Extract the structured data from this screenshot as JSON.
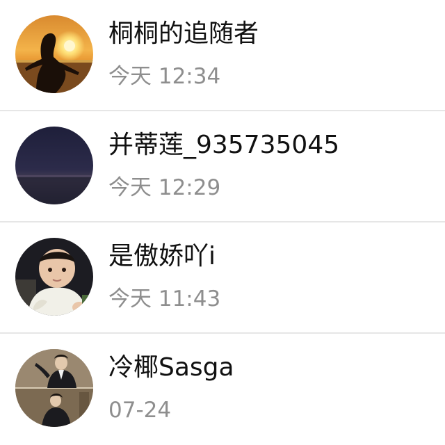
{
  "items": [
    {
      "name": "桐桐的追随者",
      "time": "今天 12:34",
      "avatar": "sunset-silhouette"
    },
    {
      "name": "并蒂莲_935735045",
      "time": "今天 12:29",
      "avatar": "dark-dusk-sky"
    },
    {
      "name": "是傲娇吖i",
      "time": "今天 11:43",
      "avatar": "baby-photo"
    },
    {
      "name": "冷椰Sasga",
      "time": "07-24",
      "avatar": "man-in-suit-collage"
    }
  ],
  "colors": {
    "name_text": "#111111",
    "time_text": "#8e8e8e",
    "separator": "#e6e6e6"
  }
}
